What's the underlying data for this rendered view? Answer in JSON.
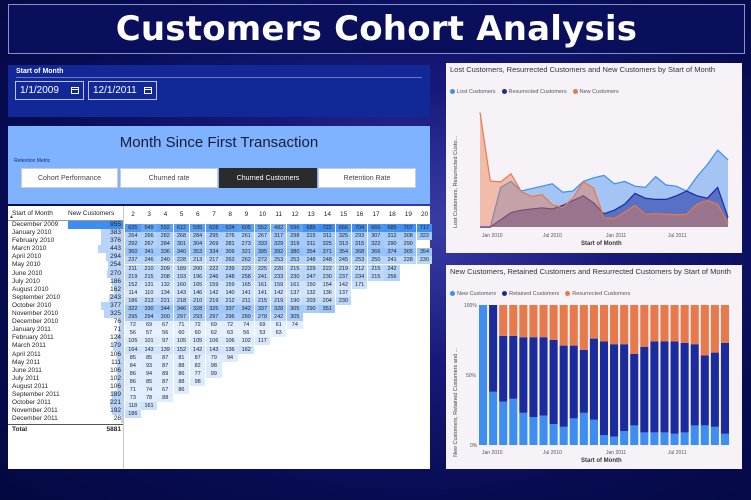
{
  "header": {
    "title": "Customers Cohort Analysis"
  },
  "date_slicer": {
    "label": "Start of Month",
    "start": "1/1/2009",
    "end": "12/1/2011"
  },
  "matrix_header": {
    "title": "Month Since First Transaction"
  },
  "retention": {
    "label": "Retention Metric",
    "buttons": [
      "Cohort Performance",
      "Churned rate",
      "Churned Customers",
      "Retention Rate"
    ],
    "selected": "Churned Customers"
  },
  "customers_table": {
    "col_month": "Start of Month",
    "col_new": "New Customers",
    "rows": [
      [
        "December 2009",
        "955"
      ],
      [
        "January 2010",
        "383"
      ],
      [
        "February 2010",
        "376"
      ],
      [
        "March 2010",
        "443"
      ],
      [
        "April 2010",
        "294"
      ],
      [
        "May 2010",
        "254"
      ],
      [
        "June 2010",
        "270"
      ],
      [
        "July 2010",
        "186"
      ],
      [
        "August 2010",
        "162"
      ],
      [
        "September 2010",
        "243"
      ],
      [
        "October 2010",
        "377"
      ],
      [
        "November 2010",
        "325"
      ],
      [
        "December 2010",
        "76"
      ],
      [
        "January 2011",
        "71"
      ],
      [
        "February 2011",
        "124"
      ],
      [
        "March 2011",
        "179"
      ],
      [
        "April 2011",
        "106"
      ],
      [
        "May 2011",
        "111"
      ],
      [
        "June 2011",
        "106"
      ],
      [
        "July 2011",
        "102"
      ],
      [
        "August 2011",
        "106"
      ],
      [
        "September 2011",
        "189"
      ],
      [
        "October 2011",
        "221"
      ],
      [
        "November 2011",
        "192"
      ],
      [
        "December 2011",
        "28"
      ]
    ],
    "total_label": "Total",
    "total_value": "5881"
  },
  "month_numbers": [
    "2",
    "3",
    "4",
    "5",
    "6",
    "7",
    "8",
    "9",
    "10",
    "11",
    "12",
    "13",
    "14",
    "15",
    "16",
    "17",
    "18",
    "19",
    "20"
  ],
  "matrix_rows": [
    [
      "635",
      "549",
      "592",
      "612",
      "595",
      "628",
      "634",
      "605",
      "552",
      "482",
      "596",
      "685",
      "722",
      "666",
      "704",
      "666",
      "685",
      "707",
      "717"
    ],
    [
      "264",
      "266",
      "282",
      "268",
      "284",
      "295",
      "276",
      "261",
      "267",
      "317",
      "298",
      "315",
      "311",
      "325",
      "293",
      "307",
      "312",
      "308",
      "322"
    ],
    [
      "292",
      "267",
      "284",
      "301",
      "304",
      "269",
      "281",
      "273",
      "333",
      "329",
      "319",
      "311",
      "325",
      "313",
      "315",
      "322",
      "290",
      "290",
      ""
    ],
    [
      "360",
      "341",
      "336",
      "340",
      "353",
      "334",
      "309",
      "321",
      "395",
      "392",
      "380",
      "354",
      "371",
      "354",
      "368",
      "366",
      "374",
      "365",
      "354"
    ],
    [
      "237",
      "246",
      "240",
      "228",
      "213",
      "217",
      "263",
      "262",
      "272",
      "253",
      "253",
      "248",
      "248",
      "245",
      "253",
      "250",
      "241",
      "228",
      "230"
    ],
    [
      "211",
      "210",
      "209",
      "189",
      "200",
      "222",
      "239",
      "223",
      "225",
      "220",
      "215",
      "229",
      "222",
      "219",
      "212",
      "215",
      "242",
      ""
    ],
    [
      "219",
      "215",
      "208",
      "193",
      "196",
      "246",
      "248",
      "258",
      "241",
      "233",
      "230",
      "247",
      "230",
      "237",
      "234",
      "215",
      "256"
    ],
    [
      "152",
      "131",
      "132",
      "160",
      "165",
      "159",
      "159",
      "165",
      "161",
      "159",
      "161",
      "150",
      "154",
      "142",
      "171"
    ],
    [
      "114",
      "110",
      "134",
      "143",
      "146",
      "142",
      "140",
      "141",
      "141",
      "142",
      "137",
      "132",
      "136",
      "137"
    ],
    [
      "186",
      "213",
      "221",
      "218",
      "210",
      "219",
      "212",
      "211",
      "215",
      "219",
      "190",
      "203",
      "204",
      "230"
    ],
    [
      "322",
      "330",
      "344",
      "346",
      "328",
      "325",
      "337",
      "342",
      "337",
      "328",
      "305",
      "290",
      "351"
    ],
    [
      "295",
      "294",
      "300",
      "297",
      "293",
      "297",
      "296",
      "289",
      "278",
      "242",
      "305"
    ],
    [
      "72",
      "69",
      "67",
      "71",
      "72",
      "69",
      "72",
      "74",
      "69",
      "61",
      "74"
    ],
    [
      "56",
      "57",
      "56",
      "60",
      "60",
      "62",
      "63",
      "56",
      "53",
      "63"
    ],
    [
      "105",
      "101",
      "97",
      "105",
      "105",
      "106",
      "106",
      "102",
      "117"
    ],
    [
      "164",
      "143",
      "139",
      "152",
      "142",
      "143",
      "136",
      "162"
    ],
    [
      "85",
      "85",
      "87",
      "81",
      "87",
      "79",
      "94"
    ],
    [
      "84",
      "93",
      "87",
      "88",
      "82",
      "98"
    ],
    [
      "86",
      "94",
      "89",
      "86",
      "77",
      "99"
    ],
    [
      "86",
      "85",
      "87",
      "88",
      "98"
    ],
    [
      "71",
      "74",
      "67",
      "86"
    ],
    [
      "73",
      "78",
      "88"
    ],
    [
      "118",
      "161"
    ],
    [
      "186"
    ]
  ],
  "chart1": {
    "title": "Lost Customers, Resurrected Customers and New Customers by Start of Month",
    "legend": [
      "Lost Customers",
      "Resurrected Customers",
      "New Customers"
    ],
    "colors": {
      "lost": "#3d8ef0",
      "resurrected": "#1a2b9e",
      "new": "#e8794a"
    },
    "ylabel": "Lost Customers, Resurrected Custo...",
    "xlabel": "Start of Month",
    "xticks": [
      "Jan 2010",
      "Jul 2010",
      "Jan 2011",
      "Jul 2011"
    ]
  },
  "chart2": {
    "title": "New Customers, Retained Customers and Resurrected Customers by Start of Month",
    "legend": [
      "New Customers",
      "Retained Customers",
      "Resurrected Customers"
    ],
    "colors": {
      "new": "#3d8ef0",
      "retained": "#1a2b9e",
      "resurrected": "#e8794a"
    },
    "ylabel": "New Customers, Retained Customers and ...",
    "xlabel": "Start of Month",
    "yticks": [
      "100%",
      "50%",
      "0%"
    ],
    "xticks": [
      "Jan 2010",
      "Jul 2010",
      "Jan 2011",
      "Jul 2011"
    ]
  },
  "chart_data": [
    {
      "type": "area",
      "title": "Lost Customers, Resurrected Customers and New Customers by Start of Month",
      "xlabel": "Start of Month",
      "ylabel": "Lost Customers, Resurrected Custo...",
      "categories": [
        "Dec 2009",
        "Jan 2010",
        "Feb 2010",
        "Mar 2010",
        "Apr 2010",
        "May 2010",
        "Jun 2010",
        "Jul 2010",
        "Aug 2010",
        "Sep 2010",
        "Oct 2010",
        "Nov 2010",
        "Dec 2010",
        "Jan 2011",
        "Feb 2011",
        "Mar 2011",
        "Apr 2011",
        "May 2011",
        "Jun 2011",
        "Jul 2011",
        "Aug 2011",
        "Sep 2011",
        "Oct 2011",
        "Nov 2011",
        "Dec 2011"
      ],
      "series": [
        {
          "name": "Lost Customers",
          "values": [
            0,
            0,
            330,
            380,
            300,
            320,
            340,
            360,
            290,
            300,
            380,
            410,
            430,
            360,
            380,
            340,
            330,
            420,
            350,
            340,
            300,
            420,
            520,
            640,
            560
          ]
        },
        {
          "name": "Resurrected Customers",
          "values": [
            0,
            0,
            60,
            120,
            140,
            150,
            160,
            150,
            180,
            220,
            260,
            200,
            110,
            140,
            190,
            280,
            240,
            230,
            230,
            260,
            300,
            260,
            240,
            330,
            80
          ]
        },
        {
          "name": "New Customers",
          "values": [
            955,
            383,
            376,
            443,
            294,
            254,
            270,
            186,
            162,
            243,
            377,
            325,
            76,
            71,
            124,
            179,
            106,
            111,
            106,
            102,
            106,
            189,
            221,
            192,
            28
          ]
        }
      ]
    },
    {
      "type": "bar",
      "stacked": true,
      "title": "New Customers, Retained Customers and Resurrected Customers by Start of Month",
      "xlabel": "Start of Month",
      "ylabel": "New Customers, Retained Customers and ...",
      "ylim": [
        0,
        100
      ],
      "categories": [
        "Dec 2009",
        "Jan 2010",
        "Feb 2010",
        "Mar 2010",
        "Apr 2010",
        "May 2010",
        "Jun 2010",
        "Jul 2010",
        "Aug 2010",
        "Sep 2010",
        "Oct 2010",
        "Nov 2010",
        "Dec 2010",
        "Jan 2011",
        "Feb 2011",
        "Mar 2011",
        "Apr 2011",
        "May 2011",
        "Jun 2011",
        "Jul 2011",
        "Aug 2011",
        "Sep 2011",
        "Oct 2011",
        "Nov 2011",
        "Dec 2011"
      ],
      "series": [
        {
          "name": "New Customers",
          "values": [
            100,
            38,
            31,
            33,
            23,
            20,
            21,
            15,
            13,
            19,
            23,
            18,
            7,
            6,
            10,
            14,
            9,
            9,
            9,
            8,
            9,
            14,
            14,
            13,
            8
          ]
        },
        {
          "name": "Retained Customers",
          "values": [
            0,
            62,
            47,
            45,
            54,
            57,
            56,
            60,
            58,
            52,
            45,
            58,
            67,
            66,
            62,
            51,
            61,
            65,
            65,
            66,
            64,
            58,
            50,
            53,
            65
          ]
        },
        {
          "name": "Resurrected Customers",
          "values": [
            0,
            0,
            22,
            22,
            23,
            23,
            23,
            25,
            29,
            29,
            32,
            24,
            26,
            28,
            28,
            35,
            30,
            26,
            26,
            26,
            27,
            28,
            36,
            34,
            27
          ]
        }
      ]
    }
  ]
}
